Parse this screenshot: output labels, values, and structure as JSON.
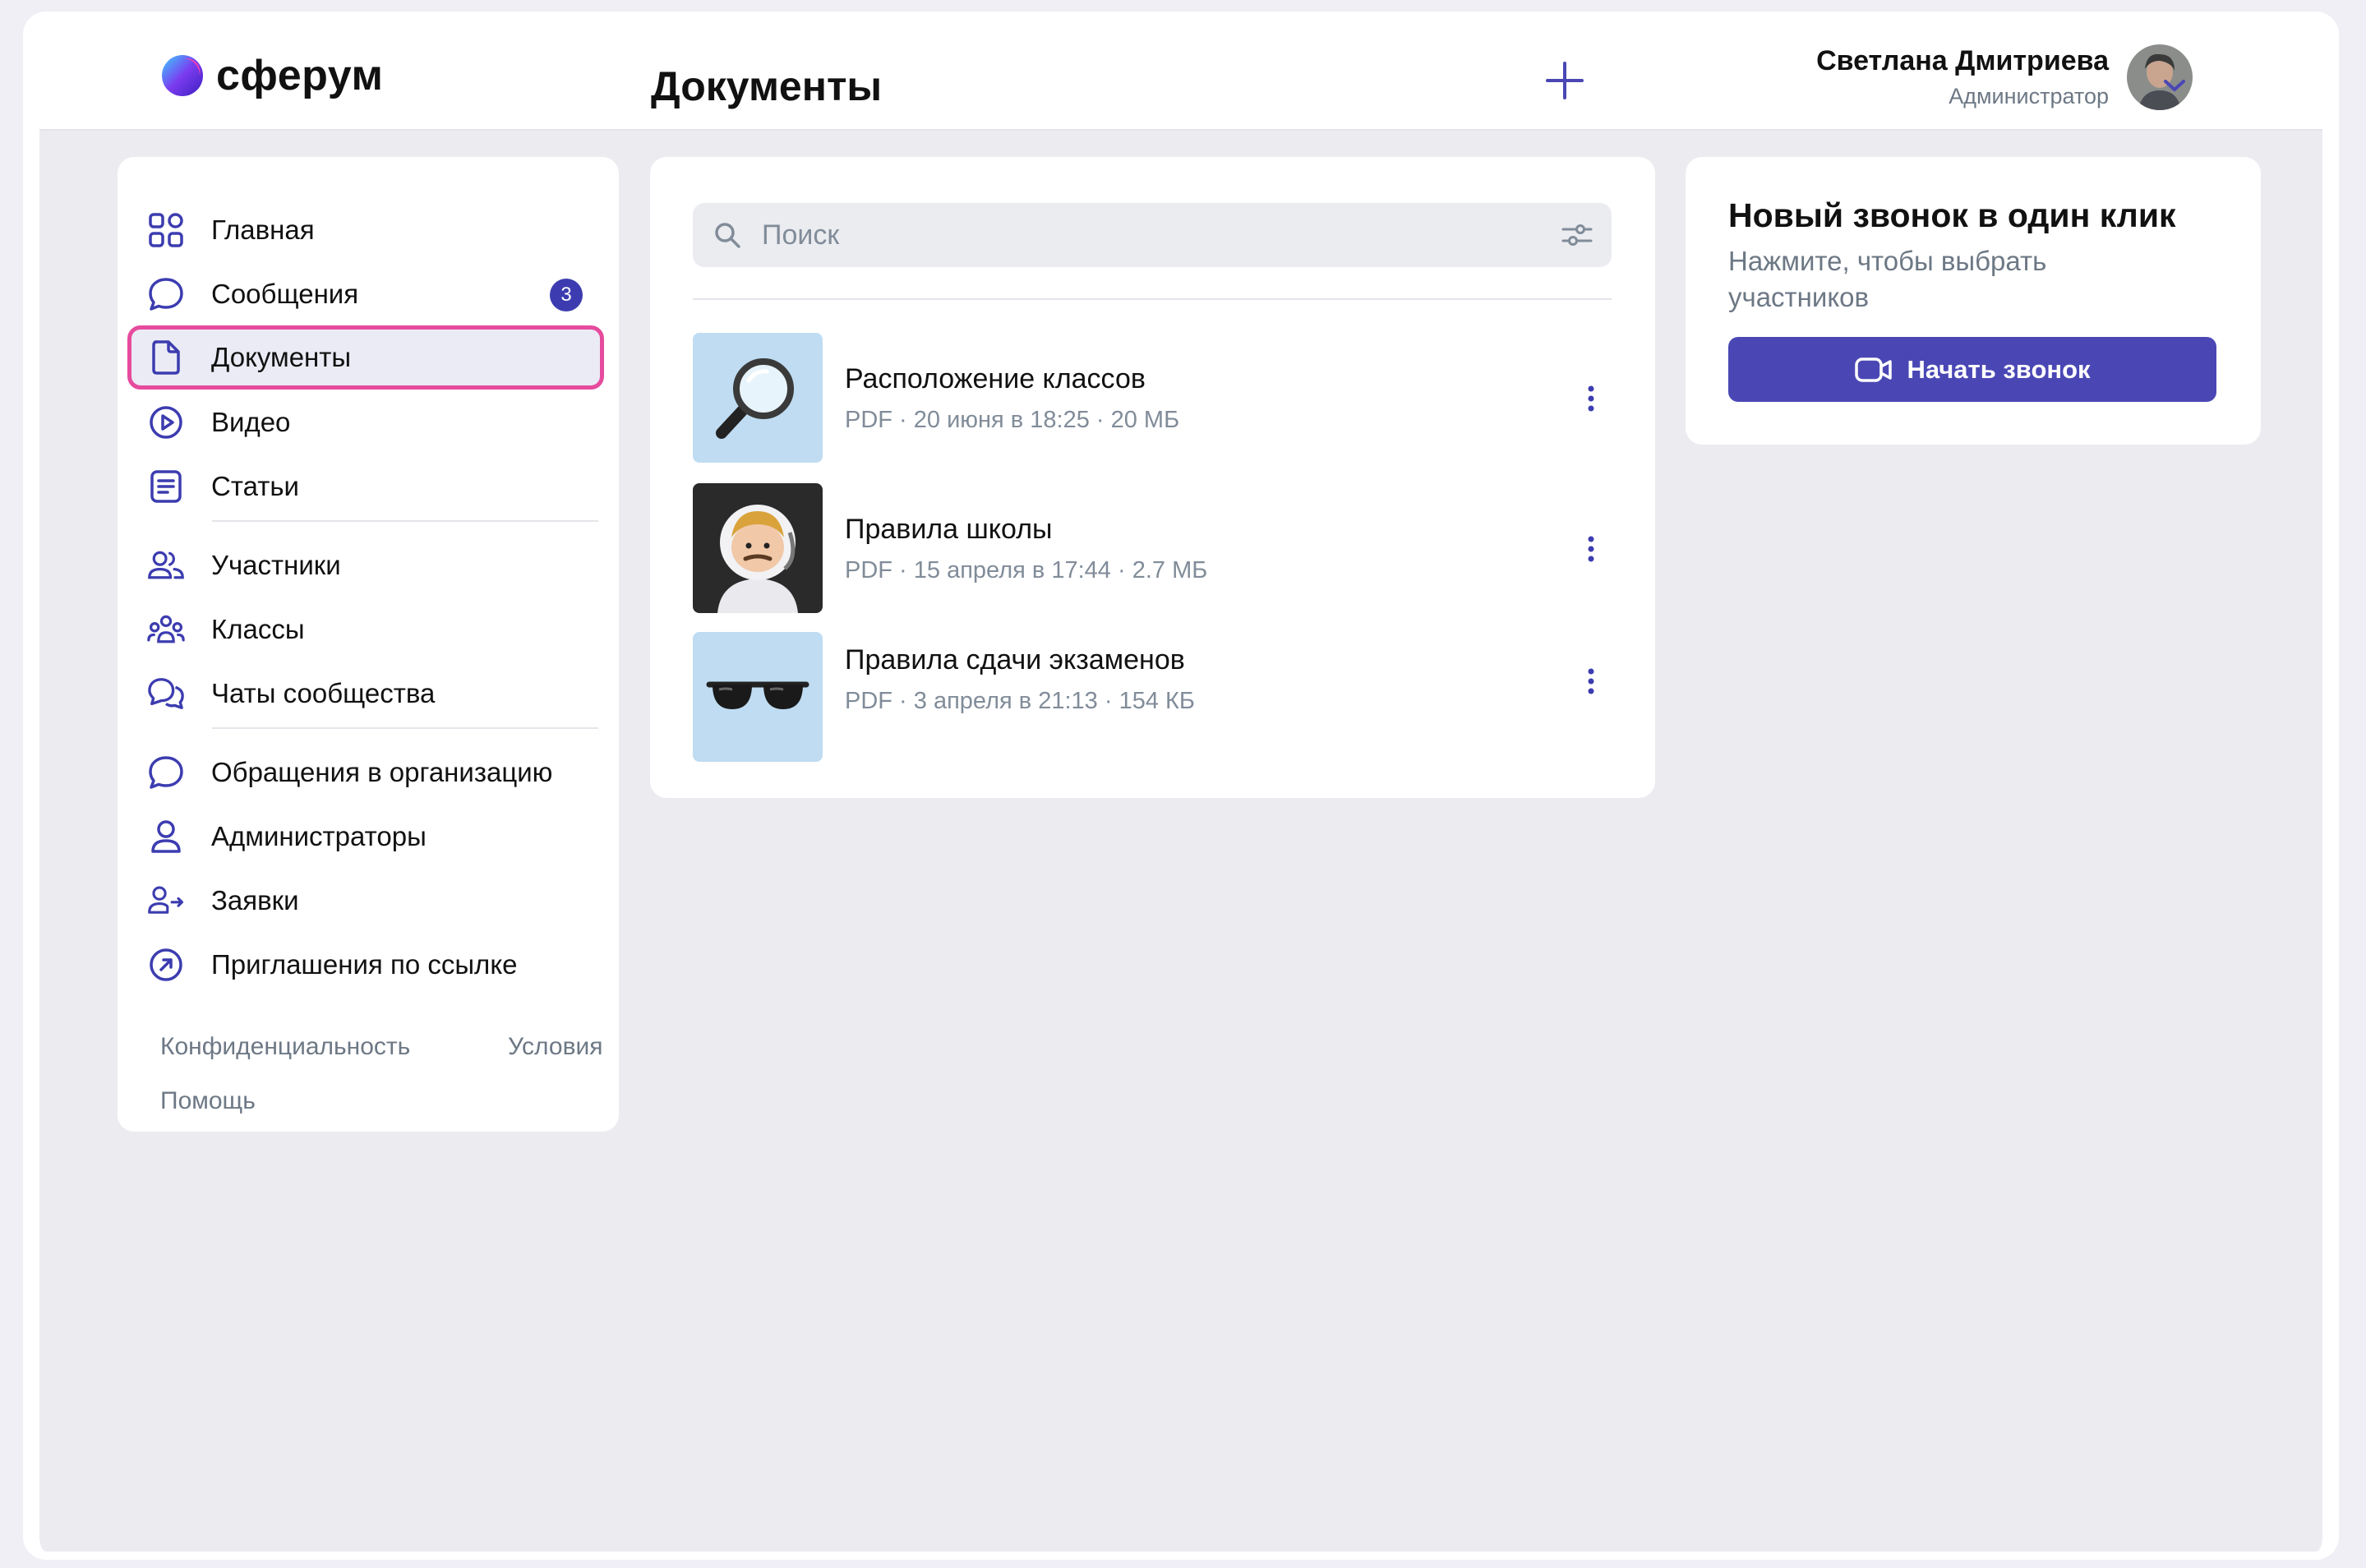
{
  "app": {
    "logo_text": "сферум",
    "page_title": "Документы"
  },
  "user": {
    "name": "Светлана Дмитриева",
    "role": "Администратор"
  },
  "sidebar": {
    "items": [
      {
        "label": "Главная",
        "icon": "grid-icon"
      },
      {
        "label": "Сообщения",
        "icon": "message-icon",
        "badge": "3"
      },
      {
        "label": "Документы",
        "icon": "document-icon",
        "active": true
      },
      {
        "label": "Видео",
        "icon": "play-icon"
      },
      {
        "label": "Статьи",
        "icon": "article-icon"
      },
      {
        "label": "Участники",
        "icon": "users-icon"
      },
      {
        "label": "Классы",
        "icon": "group-icon"
      },
      {
        "label": "Чаты сообщества",
        "icon": "chats-icon"
      },
      {
        "label": "Обращения в организацию",
        "icon": "message-icon"
      },
      {
        "label": "Администраторы",
        "icon": "user-icon"
      },
      {
        "label": "Заявки",
        "icon": "user-arrow-icon"
      },
      {
        "label": "Приглашения по ссылке",
        "icon": "link-arrow-icon"
      }
    ],
    "footer": {
      "privacy": "Конфиденциальность",
      "terms": "Условия",
      "help": "Помощь"
    }
  },
  "search": {
    "placeholder": "Поиск",
    "value": ""
  },
  "documents": [
    {
      "title": "Расположение классов",
      "meta": "PDF · 20 июня в 18:25 · 20 МБ",
      "thumb": "magnifier"
    },
    {
      "title": "Правила школы",
      "meta": "PDF · 15 апреля в 17:44 · 2.7 МБ",
      "thumb": "astronaut"
    },
    {
      "title": "Правила сдачи экзаменов",
      "meta": "PDF · 3 апреля в 21:13 · 154 КБ",
      "thumb": "sunglasses"
    }
  ],
  "call_card": {
    "title": "Новый звонок в один клик",
    "subtitle": "Нажмите, чтобы выбрать участников",
    "button_label": "Начать звонок"
  },
  "colors": {
    "accent": "#4a47b5",
    "icon": "#3c3cb0",
    "active_outline": "#e64b9d",
    "badge": "#3c3cb0"
  }
}
